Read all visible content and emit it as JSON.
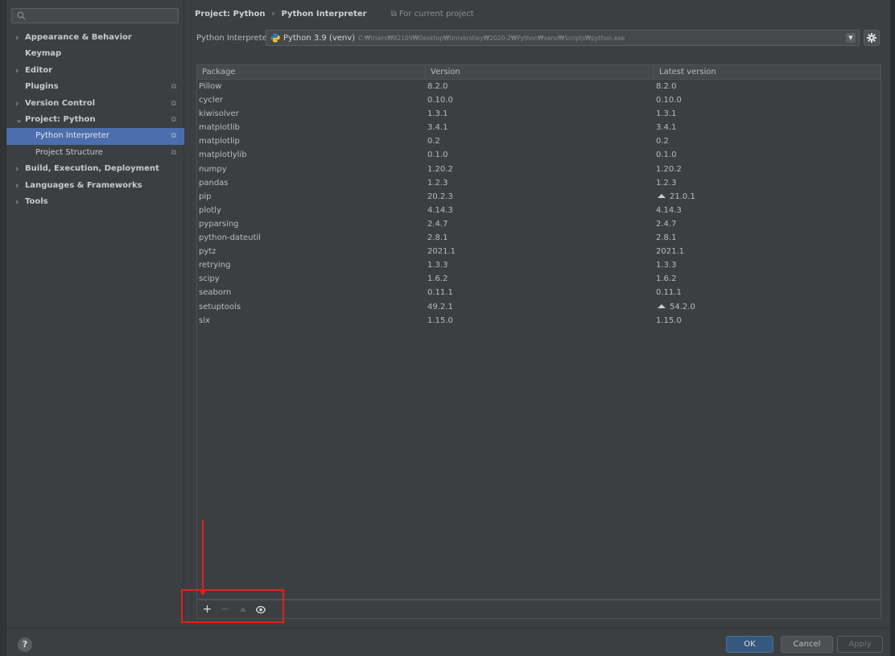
{
  "sidebar": {
    "search_placeholder": "",
    "items": [
      {
        "label": "Appearance & Behavior",
        "chevron": "›",
        "proj": ""
      },
      {
        "label": "Keymap",
        "chevron": "",
        "proj": ""
      },
      {
        "label": "Editor",
        "chevron": "›",
        "proj": ""
      },
      {
        "label": "Plugins",
        "chevron": "",
        "proj": "⧉"
      },
      {
        "label": "Version Control",
        "chevron": "›",
        "proj": "⧉"
      },
      {
        "label": "Project: Python",
        "chevron": "⌄",
        "proj": "⧉"
      },
      {
        "label": "Python Interpreter",
        "chevron": "",
        "proj": "⧉"
      },
      {
        "label": "Project Structure",
        "chevron": "",
        "proj": "⧉"
      },
      {
        "label": "Build, Execution, Deployment",
        "chevron": "›",
        "proj": ""
      },
      {
        "label": "Languages & Frameworks",
        "chevron": "›",
        "proj": ""
      },
      {
        "label": "Tools",
        "chevron": "›",
        "proj": ""
      }
    ]
  },
  "breadcrumb": {
    "project": "Project: Python",
    "separator": "›",
    "page": "Python Interpreter",
    "scope": "⧉ For current project"
  },
  "interpreter": {
    "label": "Python Interpreter:",
    "name": "Python 3.9 (venv)",
    "path": "C:₩Users₩82109₩Desktop₩Universtiey₩2020-2₩Python₩venv₩Scripts₩python.exe"
  },
  "table": {
    "headers": [
      "Package",
      "Version",
      "Latest version"
    ],
    "rows": [
      {
        "package": "Pillow",
        "version": "8.2.0",
        "latest": "8.2.0",
        "upgrade": false
      },
      {
        "package": "cycler",
        "version": "0.10.0",
        "latest": "0.10.0",
        "upgrade": false
      },
      {
        "package": "kiwisolver",
        "version": "1.3.1",
        "latest": "1.3.1",
        "upgrade": false
      },
      {
        "package": "matplotlib",
        "version": "3.4.1",
        "latest": "3.4.1",
        "upgrade": false
      },
      {
        "package": "matplotlip",
        "version": "0.2",
        "latest": "0.2",
        "upgrade": false
      },
      {
        "package": "matplotlylib",
        "version": "0.1.0",
        "latest": "0.1.0",
        "upgrade": false
      },
      {
        "package": "numpy",
        "version": "1.20.2",
        "latest": "1.20.2",
        "upgrade": false
      },
      {
        "package": "pandas",
        "version": "1.2.3",
        "latest": "1.2.3",
        "upgrade": false
      },
      {
        "package": "pip",
        "version": "20.2.3",
        "latest": "21.0.1",
        "upgrade": true
      },
      {
        "package": "plotly",
        "version": "4.14.3",
        "latest": "4.14.3",
        "upgrade": false
      },
      {
        "package": "pyparsing",
        "version": "2.4.7",
        "latest": "2.4.7",
        "upgrade": false
      },
      {
        "package": "python-dateutil",
        "version": "2.8.1",
        "latest": "2.8.1",
        "upgrade": false
      },
      {
        "package": "pytz",
        "version": "2021.1",
        "latest": "2021.1",
        "upgrade": false
      },
      {
        "package": "retrying",
        "version": "1.3.3",
        "latest": "1.3.3",
        "upgrade": false
      },
      {
        "package": "scipy",
        "version": "1.6.2",
        "latest": "1.6.2",
        "upgrade": false
      },
      {
        "package": "seaborn",
        "version": "0.11.1",
        "latest": "0.11.1",
        "upgrade": false
      },
      {
        "package": "setuptools",
        "version": "49.2.1",
        "latest": "54.2.0",
        "upgrade": true
      },
      {
        "package": "six",
        "version": "1.15.0",
        "latest": "1.15.0",
        "upgrade": false
      }
    ]
  },
  "toolbar": {
    "add": "+",
    "remove": "−"
  },
  "footer": {
    "help": "?",
    "ok": "OK",
    "cancel": "Cancel",
    "apply": "Apply"
  },
  "colors": {
    "selection": "#4b6eaf",
    "annotation": "#e3201b",
    "ok_button": "#365880"
  }
}
